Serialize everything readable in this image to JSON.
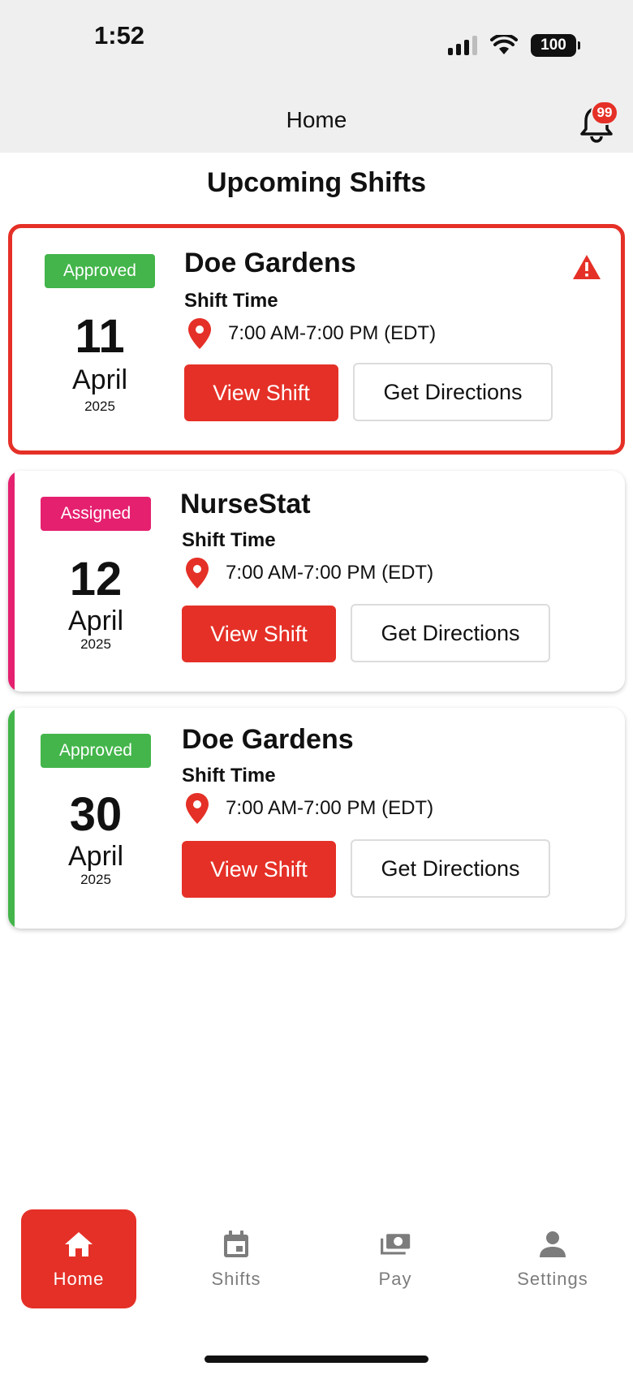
{
  "status_bar": {
    "time": "1:52",
    "battery": "100"
  },
  "header": {
    "title": "Home",
    "notification_count": "99"
  },
  "section_title": "Upcoming Shifts",
  "colors": {
    "brand_red": "#e53027",
    "approved_green": "#43b54a",
    "assigned_pink": "#e5206f"
  },
  "shifts": [
    {
      "status": "Approved",
      "day": "11",
      "month": "April",
      "year": "2025",
      "facility": "Doe Gardens",
      "shift_label": "Shift Time",
      "time": "7:00 AM-7:00 PM (EDT)",
      "view_label": "View Shift",
      "directions_label": "Get Directions",
      "alert": true,
      "accent_color": "#e53027",
      "badge_color": "#43b54a"
    },
    {
      "status": "Assigned",
      "day": "12",
      "month": "April",
      "year": "2025",
      "facility": "NurseStat",
      "shift_label": "Shift Time",
      "time": "7:00 AM-7:00 PM (EDT)",
      "view_label": "View Shift",
      "directions_label": "Get Directions",
      "alert": false,
      "accent_color": "#e5206f",
      "badge_color": "#e5206f"
    },
    {
      "status": "Approved",
      "day": "30",
      "month": "April",
      "year": "2025",
      "facility": "Doe Gardens",
      "shift_label": "Shift Time",
      "time": "7:00 AM-7:00 PM (EDT)",
      "view_label": "View Shift",
      "directions_label": "Get Directions",
      "alert": false,
      "accent_color": "#43b54a",
      "badge_color": "#43b54a"
    }
  ],
  "tabs": [
    {
      "label": "Home",
      "icon": "home-icon",
      "active": true
    },
    {
      "label": "Shifts",
      "icon": "calendar-icon",
      "active": false
    },
    {
      "label": "Pay",
      "icon": "money-icon",
      "active": false
    },
    {
      "label": "Settings",
      "icon": "person-icon",
      "active": false
    }
  ]
}
